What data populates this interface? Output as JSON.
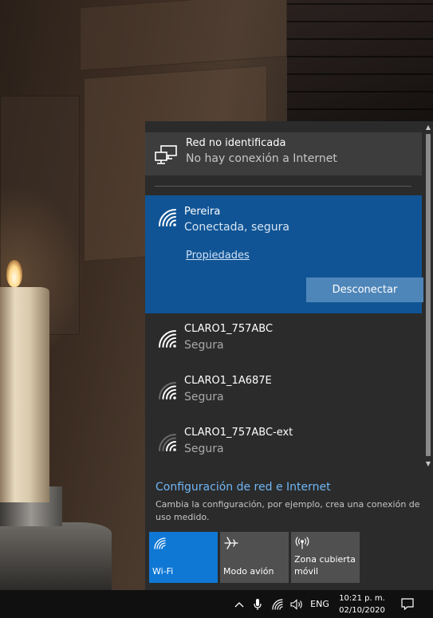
{
  "flyout": {
    "unidentified_network": {
      "title": "Red no identificada",
      "status": "No hay conexión a Internet",
      "icon": "wired-network-icon"
    },
    "connected_network": {
      "ssid": "Pereira",
      "status": "Conectada, segura",
      "properties_label": "Propiedades",
      "disconnect_label": "Desconectar",
      "icon": "wifi-signal-full-icon"
    },
    "networks": [
      {
        "ssid": "CLARO1_757ABC",
        "security": "Segura",
        "signal": 4
      },
      {
        "ssid": "CLARO1_1A687E",
        "security": "Segura",
        "signal": 3
      },
      {
        "ssid": "CLARO1_757ABC-ext",
        "security": "Segura",
        "signal": 2
      }
    ],
    "settings": {
      "link_label": "Configuración de red e Internet",
      "description": "Cambia la configuración, por ejemplo, crea una conexión de uso medido."
    },
    "quick_actions": [
      {
        "label": "Wi-Fi",
        "icon": "wifi-icon",
        "active": true
      },
      {
        "label": "Modo avión",
        "icon": "airplane-icon",
        "active": false
      },
      {
        "label": "Zona cubierta móvil",
        "icon": "mobile-hotspot-icon",
        "active": false
      }
    ]
  },
  "taskbar": {
    "language": "ENG",
    "time": "10:21 p. m.",
    "date": "02/10/2020"
  },
  "colors": {
    "flyout_bg": "#2b2b2b",
    "connected_bg": "#105495",
    "accent": "#0f78d4",
    "link": "#6fb6f5",
    "taskbar_bg": "#101010"
  }
}
